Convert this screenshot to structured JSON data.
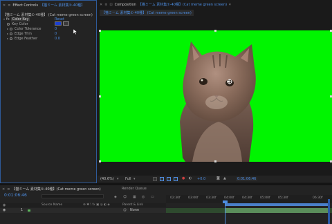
{
  "effect_controls": {
    "tab_title": "Effect Controls",
    "tab_source": "【猫ミーム 素材集①-40種】",
    "header_comp": "【猫ミーム 素材集①-40種】",
    "header_layer": "(Cat meme green screen)",
    "effect_name": "Color Key",
    "reset_label": "Reset",
    "properties": [
      {
        "label": "Key Color",
        "value": ""
      },
      {
        "label": "Color Tolerance",
        "value": "0"
      },
      {
        "label": "Edge Thin",
        "value": "0"
      },
      {
        "label": "Edge Feather",
        "value": "0.0"
      }
    ],
    "key_color": "#1b3fd4"
  },
  "composition": {
    "tab_title": "Composition",
    "tab_source": "【猫ミーム 素材集①-40種】",
    "tab_layer": "(Cat meme green screen)",
    "breadcrumb": "【猫ミーム 素材集①-40種】",
    "breadcrumb_layer": "(Cat meme green screen)",
    "background_color": "#00f500",
    "zoom": "(40.6%)",
    "resolution": "Full",
    "exposure": "+0.0",
    "timecode": "0:01:06:46"
  },
  "timeline": {
    "tab_title": "【猫ミーム 素材集①-40種】",
    "tab_layer": "(Cat meme green screen)",
    "render_queue": "Render Queue",
    "timecode": "0:01:06:46",
    "source_name_col": "Source Name",
    "parent_link_col": "Parent & Link",
    "parent_value": "None",
    "layer_number": "1",
    "ruler_ticks": [
      "02:30f",
      "03:00f",
      "03:30f",
      "04:00f",
      "04:30f",
      "05:00f",
      "05:30f",
      "06:30f"
    ]
  },
  "colors": {
    "accent": "#4d8ee3",
    "green_screen": "#00f500",
    "panel": "#232323",
    "work_area": "#4a7fc9"
  }
}
